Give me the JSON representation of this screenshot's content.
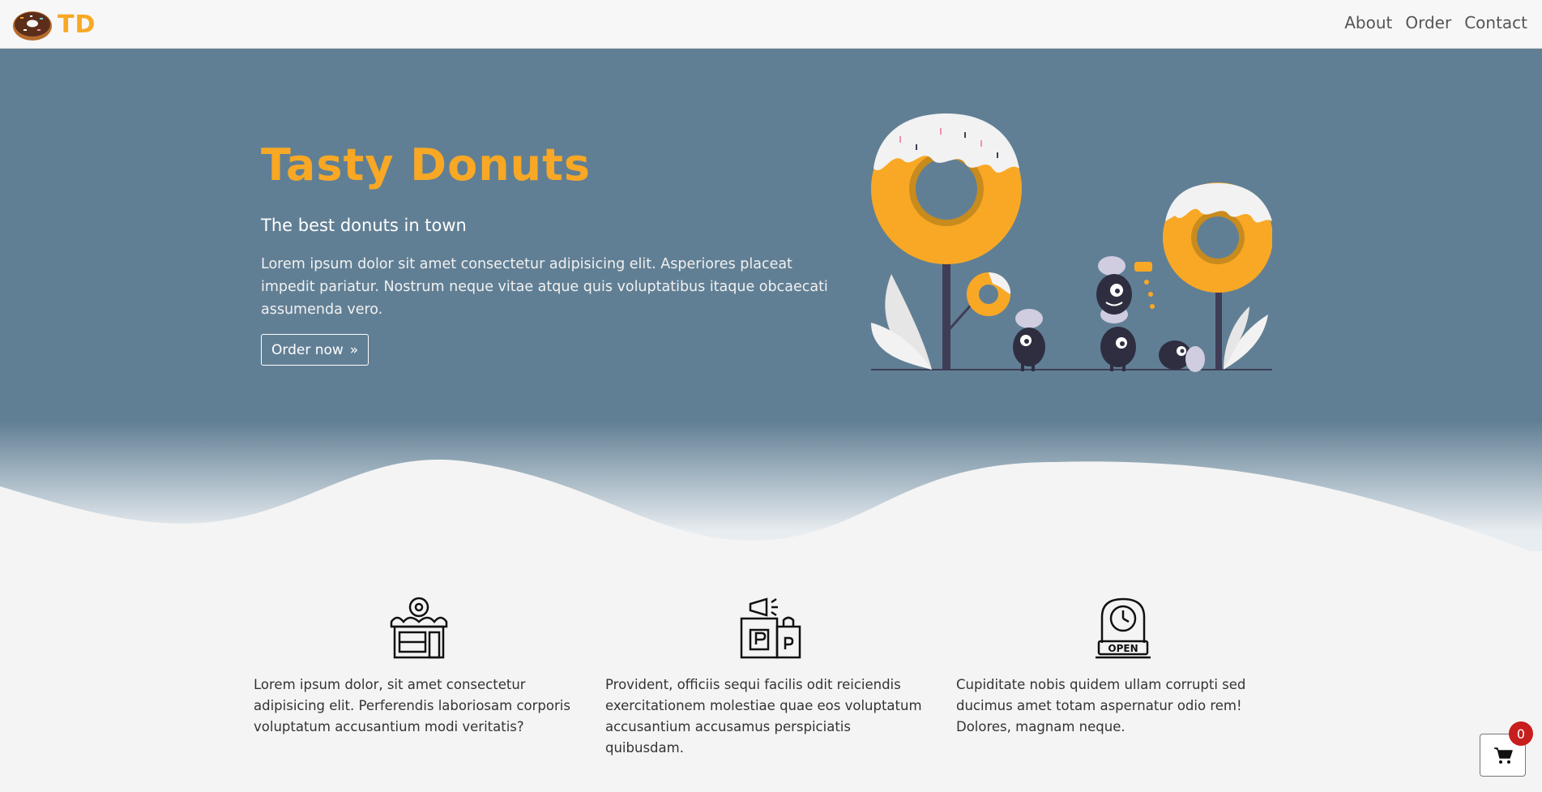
{
  "navbar": {
    "brand_text": "TD",
    "links": [
      {
        "label": "About"
      },
      {
        "label": "Order"
      },
      {
        "label": "Contact"
      }
    ]
  },
  "hero": {
    "title": "Tasty Donuts",
    "subtitle": "The best donuts in town",
    "text": "Lorem ipsum dolor sit amet consectetur adipisicing elit. Asperiores placeat impedit pariatur. Nostrum neque vitae atque quis voluptatibus itaque obcaecati assumenda vero.",
    "button_label": "Order now"
  },
  "features": [
    {
      "icon": "donut-shop-icon",
      "text": "Lorem ipsum dolor, sit amet consectetur adipisicing elit. Perferendis laboriosam corporis voluptatum accusantium modi veritatis?"
    },
    {
      "icon": "parking-shopping-icon",
      "text": "Provident, officiis sequi facilis odit reiciendis exercitationem molestiae quae eos voluptatum accusantium accusamus perspiciatis quibusdam."
    },
    {
      "icon": "open-sign-clock-icon",
      "text": "Cupiditate nobis quidem ullam corrupti sed ducimus amet totam aspernatur odio rem! Dolores, magnam neque."
    }
  ],
  "cart": {
    "count": "0"
  },
  "colors": {
    "accent": "#f8a824",
    "hero_bg": "#617f94",
    "page_bg": "#f4f4f4",
    "badge": "#c81e1e"
  }
}
